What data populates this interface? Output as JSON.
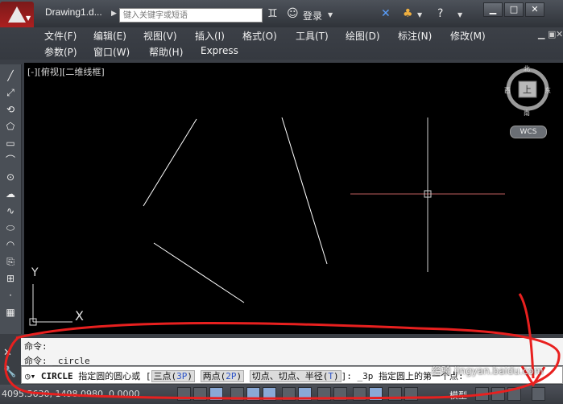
{
  "window": {
    "title": "Drawing1.d...",
    "search_placeholder": "键入关键字或短语",
    "login_label": "登录"
  },
  "menu": {
    "row1": [
      "文件(F)",
      "编辑(E)",
      "视图(V)",
      "插入(I)",
      "格式(O)",
      "工具(T)",
      "绘图(D)",
      "标注(N)",
      "修改(M)"
    ],
    "row2": [
      "参数(P)",
      "窗口(W)",
      "帮助(H)",
      "Express"
    ]
  },
  "viewport": {
    "label": "[-][俯视][二维线框]",
    "viewcube": {
      "north": "北",
      "south": "南",
      "west": "西",
      "east": "东",
      "face": "上",
      "wcs": "WCS"
    },
    "ucs": {
      "x": "X",
      "y": "Y"
    }
  },
  "command": {
    "history": [
      "命令:",
      "命令: _circle"
    ],
    "prefix": "CIRCLE",
    "prompt": "指定圆的圆心或",
    "options": [
      {
        "text": "三点",
        "key": "3P"
      },
      {
        "text": "两点",
        "key": "2P"
      },
      {
        "text": "切点、切点、半径",
        "key": "T"
      }
    ],
    "tail": ": _3p 指定圆上的第一个点:"
  },
  "status": {
    "coords": "4095.5630, 1498.0980, 0.0000",
    "model_label": "模型"
  },
  "watermark": "经验 jingyan.baidu.com"
}
